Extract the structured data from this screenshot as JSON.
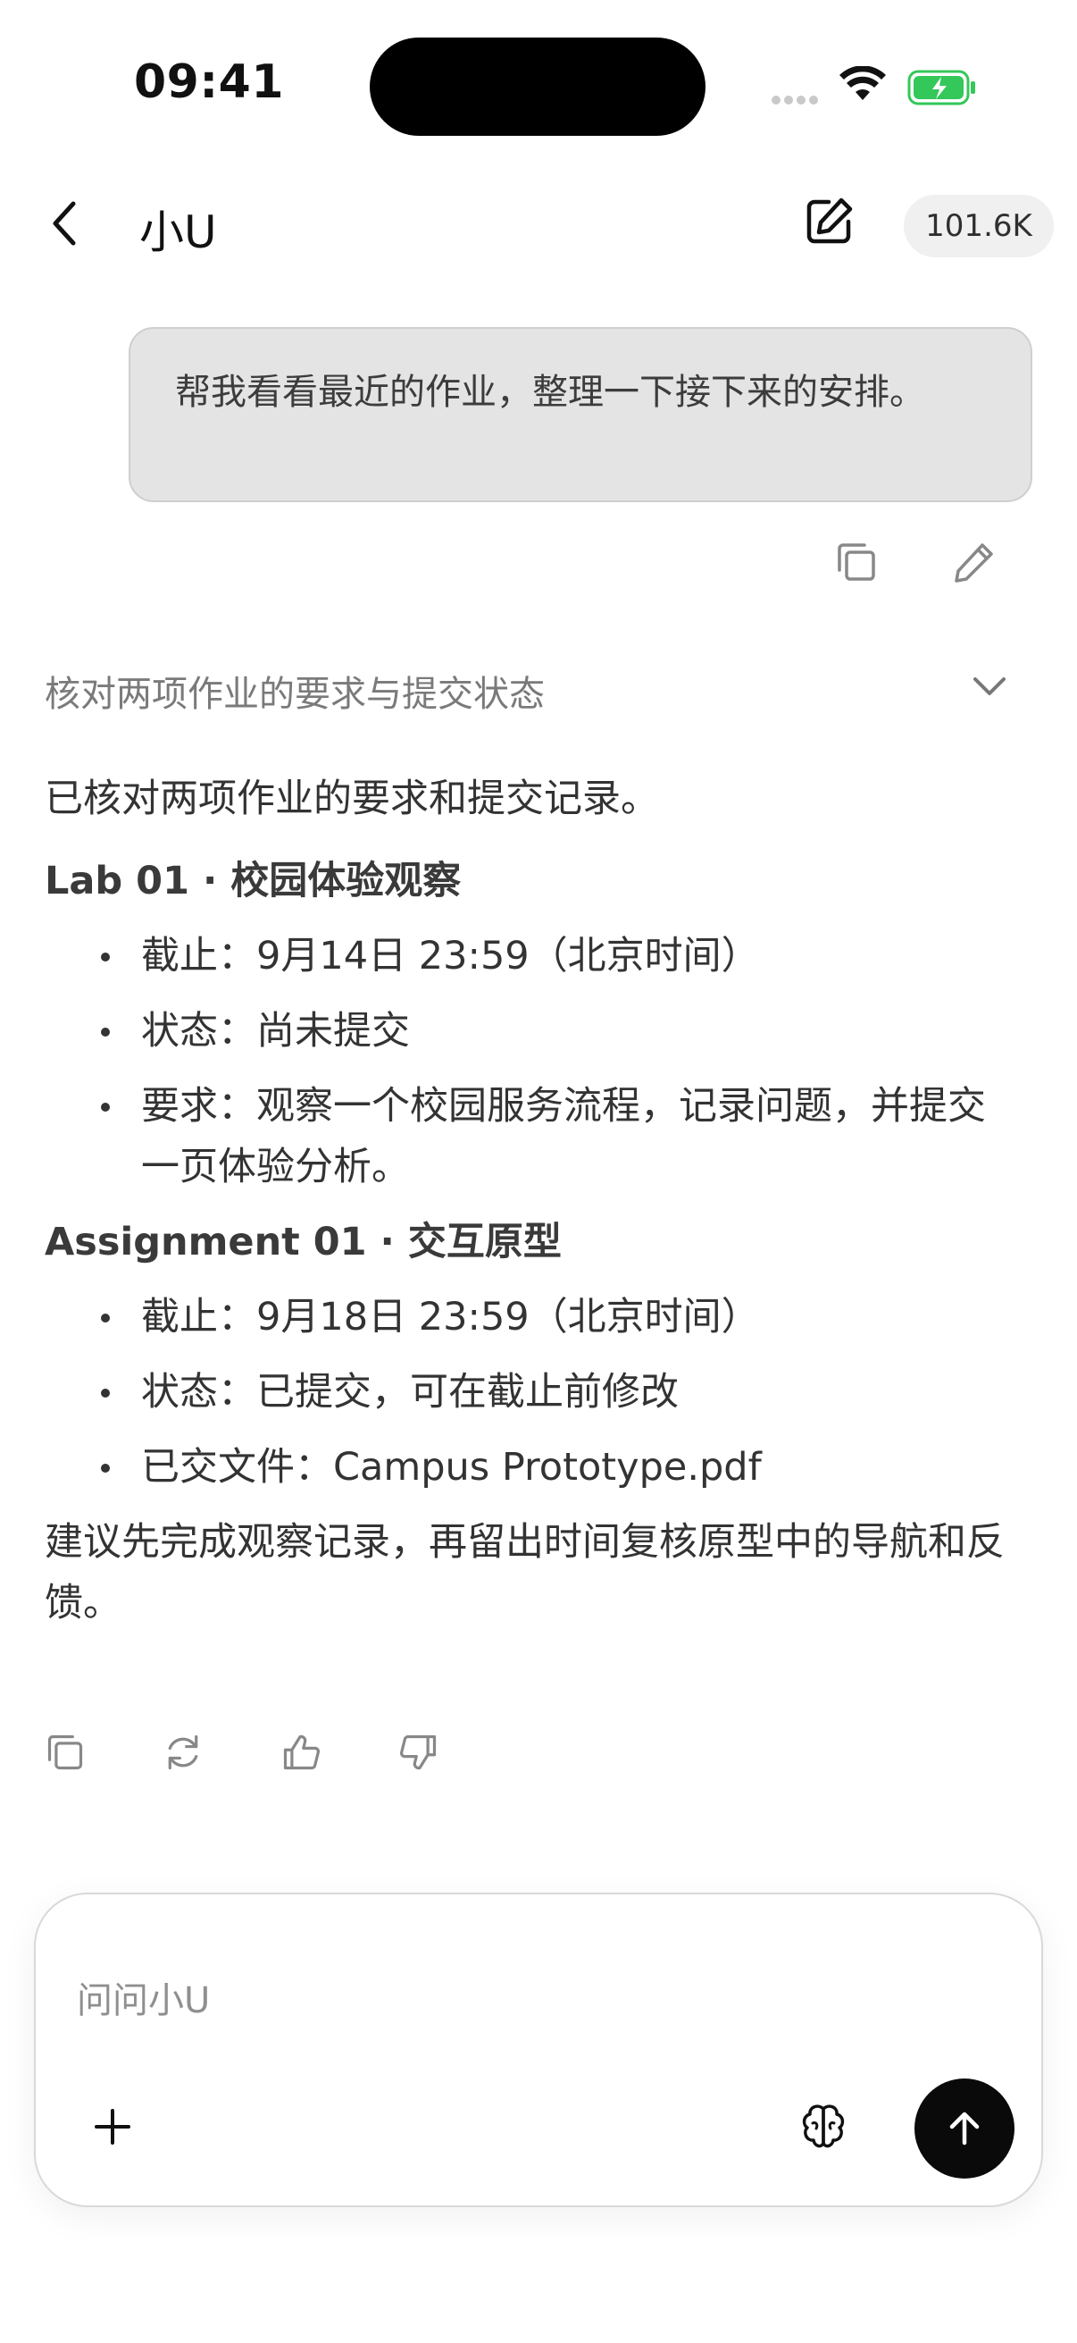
{
  "status_bar": {
    "time": "09:41"
  },
  "header": {
    "title": "小U",
    "token_count": "101.6K"
  },
  "user_message": {
    "text": "帮我看看最近的作业，整理一下接下来的安排。"
  },
  "reasoning": {
    "summary": "核对两项作业的要求与提交状态"
  },
  "answer": {
    "intro": "已核对两项作业的要求和提交记录。",
    "sections": [
      {
        "title": "Lab 01 · 校园体验观察",
        "items": [
          "截止：9月14日 23:59（北京时间）",
          "状态：尚未提交",
          "要求：观察一个校园服务流程，记录问题，并提交一页体验分析。"
        ]
      },
      {
        "title": "Assignment 01 · 交互原型",
        "items": [
          "截止：9月18日 23:59（北京时间）",
          "状态：已提交，可在截止前修改",
          "已交文件：Campus Prototype.pdf"
        ]
      }
    ],
    "conclusion": "建议先完成观察记录，再留出时间复核原型中的导航和反馈。"
  },
  "composer": {
    "placeholder": "问问小U"
  },
  "colors": {
    "battery_green": "#34c759",
    "send_button": "#0a0a0a",
    "user_bubble": "#e4e4e4"
  },
  "icons": [
    "back-icon",
    "edit-icon",
    "copy-icon",
    "pencil-icon",
    "chevron-down-icon",
    "refresh-icon",
    "thumbs-up-icon",
    "thumbs-down-icon",
    "plus-icon",
    "brain-icon",
    "arrow-up-icon"
  ]
}
